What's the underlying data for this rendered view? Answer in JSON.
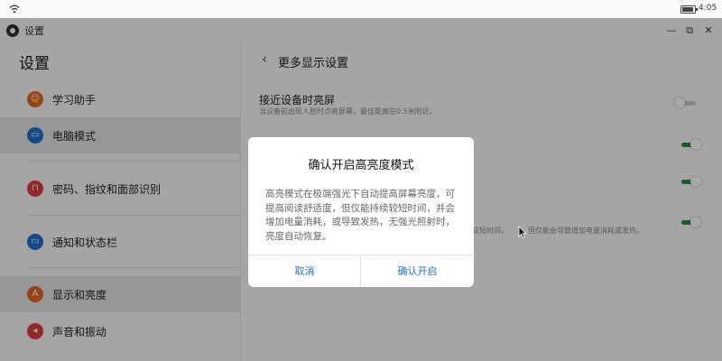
{
  "status_bar": {
    "time": "4:05",
    "battery_level": 0.9,
    "wifi_icon": "wifi-icon",
    "battery_icon": "battery-icon"
  },
  "window": {
    "title": "设置",
    "app_icon": "settings-gear-icon",
    "minimize_icon": "minimize-icon",
    "restore_icon": "restore-icon",
    "close_icon": "close-icon"
  },
  "sidebar": {
    "title": "设置",
    "items": [
      {
        "label": "学习助手",
        "icon": "study-assistant-icon",
        "color": "#e8661f",
        "glyph": "☺",
        "selected": false
      },
      {
        "label": "电脑模式",
        "icon": "computer-mode-icon",
        "color": "#1f6fd1",
        "glyph": "▭",
        "selected": true
      },
      {
        "label": "密码、指纹和面部识别",
        "icon": "lock-icon",
        "color": "#e23b3b",
        "glyph": "⊓",
        "selected": false
      },
      {
        "label": "通知和状态栏",
        "icon": "notification-icon",
        "color": "#1f6fd1",
        "glyph": "▭",
        "selected": false
      },
      {
        "label": "显示和亮度",
        "icon": "display-brightness-icon",
        "color": "#e8661f",
        "glyph": "A",
        "selected": true
      },
      {
        "label": "声音和振动",
        "icon": "sound-icon",
        "color": "#e23b3b",
        "glyph": "◂",
        "selected": false
      }
    ]
  },
  "detail": {
    "back_icon": "back-arrow-icon",
    "title": "更多显示设置",
    "proximity": {
      "title": "接近设备时亮屏",
      "desc": "当设备前出现人脸时点亮屏幕，最佳距离在0.5米附近。",
      "enabled": false
    },
    "toggles": [
      {
        "enabled": true
      },
      {
        "enabled": true
      },
      {
        "enabled": true
      }
    ],
    "bg_text_left": "较短时间，",
    "bg_text_right": "但仅能会导致增加电量消耗或发热。"
  },
  "dialog": {
    "title": "确认开启高亮度模式",
    "body": "高亮模式在极端强光下自动提高屏幕亮度，可提高阅读舒适度，但仅能持续较短时间，并会增加电量消耗，或导致发热，无强光照射时，亮度自动恢复。",
    "cancel_label": "取消",
    "confirm_label": "确认开启"
  },
  "colors": {
    "accent": "#1e73c8",
    "toggle_on": "#2e8b3e",
    "selected_bg": "#e6e6e6"
  }
}
